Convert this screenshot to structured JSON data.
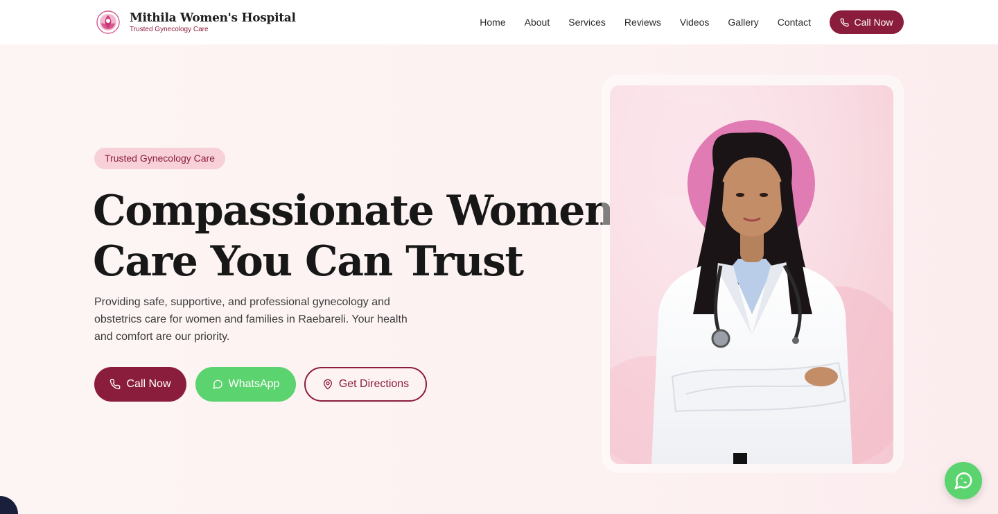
{
  "header": {
    "brand_name": "Mithila Women's Hospital",
    "brand_tagline": "Trusted Gynecology Care",
    "nav": [
      "Home",
      "About",
      "Services",
      "Reviews",
      "Videos",
      "Gallery",
      "Contact"
    ],
    "cta_label": "Call Now"
  },
  "hero": {
    "badge": "Trusted Gynecology Care",
    "headline_line1": "Compassionate Women's",
    "headline_line2": "Care You Can Trust",
    "subtext": "Providing safe, supportive, and professional gynecology and obstetrics care for women and families in Raebareli. Your health and comfort are our priority.",
    "buttons": {
      "call": "Call Now",
      "whatsapp": "WhatsApp",
      "directions": "Get Directions"
    }
  },
  "icons": {
    "phone": "phone-icon",
    "whatsapp": "whatsapp-icon",
    "map_pin": "map-pin-icon",
    "logo": "lotus-logo-icon"
  },
  "colors": {
    "brand": "#8b1d3c",
    "whatsapp": "#5bd36e",
    "badge_bg": "#f8d1d8",
    "page_bg": "#fdf3f3"
  }
}
